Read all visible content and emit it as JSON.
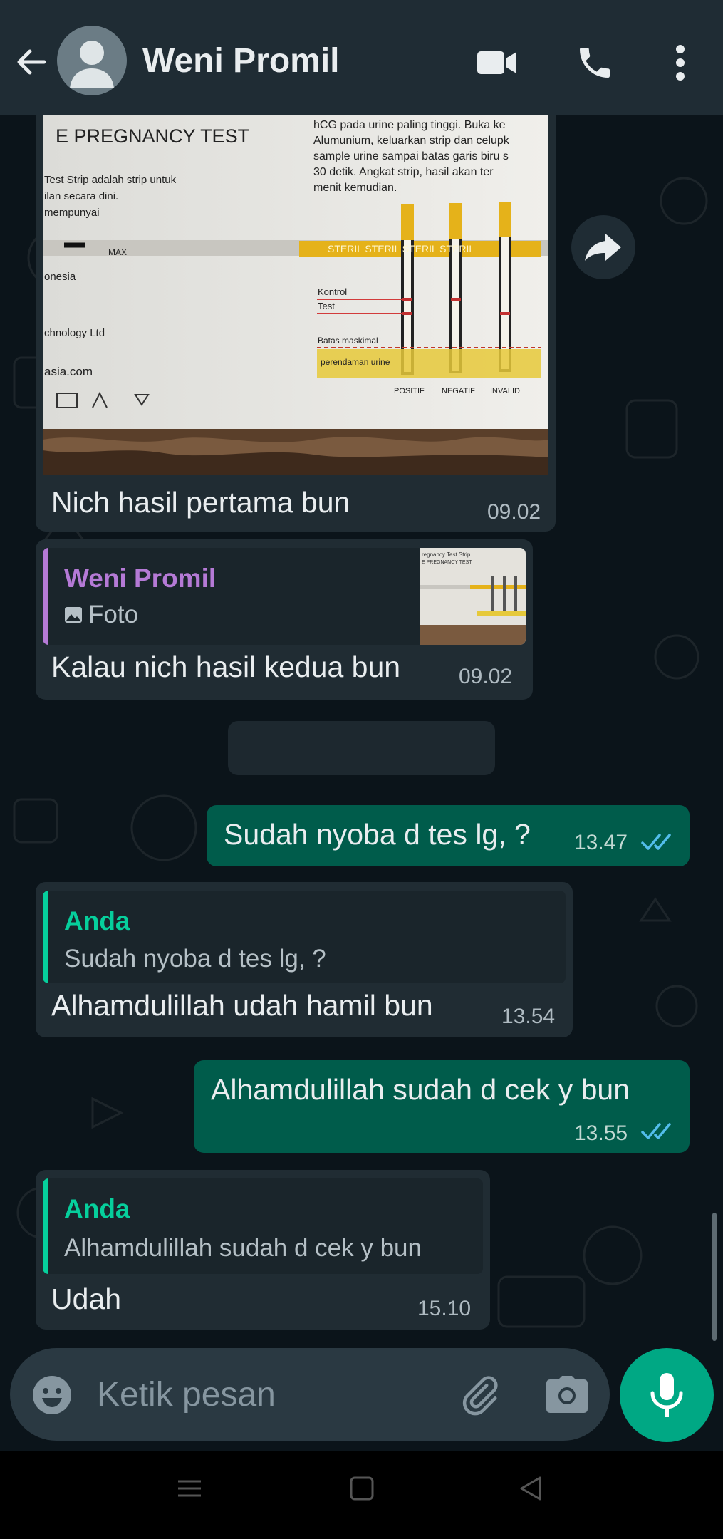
{
  "header": {
    "contact_name": "Weni Promil",
    "back_icon": "back-arrow-icon",
    "avatar_icon": "default-avatar-icon",
    "video_icon": "video-call-icon",
    "call_icon": "phone-call-icon",
    "menu_icon": "more-vert-icon"
  },
  "photo_text": {
    "title": "E PREGNANCY TEST",
    "left_lines": [
      "Test Strip adalah strip untuk",
      "ilan secara dini.",
      "mempunyai"
    ],
    "right_lines": [
      "hCG pada urine paling tinggi. Buka ke",
      "Alumunium, keluarkan strip dan celupk",
      "sample urine sampai batas garis biru s",
      "30 detik. Angkat strip, hasil akan ter",
      "menit kemudian."
    ],
    "max": "MAX",
    "brand_lines": [
      "onesia",
      "chnology Ltd",
      "asia.com"
    ],
    "band": "STERIL  STERIL  STERIL  STERIL",
    "kontrol": "Kontrol",
    "test": "Test",
    "batas": "Batas maskimal",
    "perendaman": "perendaman urine",
    "labels": [
      "POSITIF",
      "NEGATIF",
      "INVALID"
    ]
  },
  "messages": [
    {
      "id": "m1",
      "direction": "in",
      "text": "Nich hasil pertama bun",
      "time": "09.02"
    },
    {
      "id": "m2",
      "direction": "in",
      "quote_name": "Weni Promil",
      "quote_text": "Foto",
      "text": "Kalau nich hasil kedua bun",
      "time": "09.02"
    },
    {
      "id": "m3",
      "direction": "out",
      "text": "Sudah nyoba  d tes lg, ?",
      "time": "13.47"
    },
    {
      "id": "m4",
      "direction": "in",
      "quote_name": "Anda",
      "quote_text": "Sudah nyoba  d tes lg, ?",
      "text": "Alhamdulillah udah hamil bun",
      "time": "13.54"
    },
    {
      "id": "m5",
      "direction": "out",
      "text": "Alhamdulillah sudah d cek y bun",
      "time": "13.55"
    },
    {
      "id": "m6",
      "direction": "in",
      "quote_name": "Anda",
      "quote_text": "Alhamdulillah sudah d cek y bun",
      "text": "Udah",
      "time": "15.10"
    }
  ],
  "thumb_text": {
    "title": "regnancy Test Strip",
    "sub": "E PREGNANCY TEST"
  },
  "composer": {
    "placeholder": "Ketik pesan",
    "emoji_icon": "emoji-icon",
    "attach_icon": "attach-icon",
    "camera_icon": "camera-icon",
    "mic_icon": "mic-icon"
  },
  "colors": {
    "incoming_bubble": "#202c33",
    "outgoing_bubble": "#005c4b",
    "accent_green": "#00a884",
    "quote_name_purple": "#b57ad6",
    "quote_name_green": "#06cf9c",
    "read_ticks": "#53bdeb"
  }
}
